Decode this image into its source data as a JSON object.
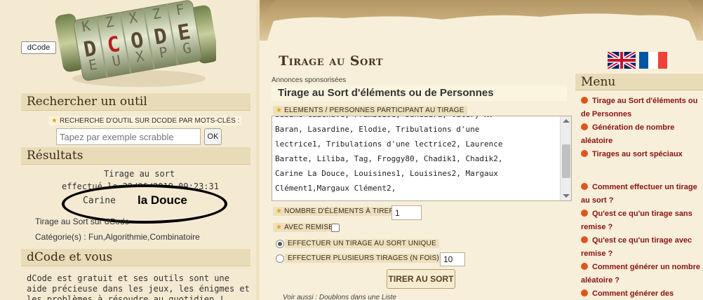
{
  "logo": {
    "badge": "dCode",
    "word": "DCODE"
  },
  "left": {
    "search": {
      "heading": "Rechercher un outil",
      "label": "RECHERCHE D'OUTIL SUR DCODE PAR MOTS-CLÉS :",
      "placeholder": "Tapez par exemple scrabble",
      "ok": "OK"
    },
    "results": {
      "heading": "Résultats",
      "line1": "Tirage au sort",
      "line2": "effectué le 22/06/2019 09:23:31",
      "carine": "Carine",
      "douce": "la Douce",
      "sur": "Tirage au Sort sur dCode",
      "cat": "Catégorie(s) : Fun,Algorithmie,Combinatoire"
    },
    "vous": {
      "heading": "dCode et vous",
      "desc": "dCode est gratuit et ses outils sont une aide précieuse dans les jeux, les énigmes et les problèmes à résoudre au quotidien !"
    }
  },
  "main": {
    "title": "Tirage au Sort",
    "sponsored": "Annonces sponsorisées",
    "ad": "Tirage au Sort d'éléments ou de Personnes",
    "elements_label": "ELEMENTS / PERSONNES PARTICIPANT AU TIRAGE",
    "textarea_lines": [
      "Sabine Cazenave, Framboise, Sandaura, Valery K.",
      "Baran, Lasardine, Elodie, Tribulations d'une",
      "lectrice1, Tribulations d'une lectrice2, Laurence",
      "Baratte, Liliba, Tag, Froggy80, Chadik1, Chadik2,",
      "Carine La Douce, Louisines1, Louisines2, Margaux",
      "Clément1,Margaux Clément2,"
    ],
    "nb_label": "NOMBRE D'ÉLÉMENTS À TIRER",
    "nb_value": "1",
    "remise_label": "AVEC REMISE",
    "unique_label": "EFFECTUER UN TIRAGE AU SORT UNIQUE",
    "multi_label": "EFFECTUER PLUSIEURS TIRAGES (N FOIS) N=",
    "multi_value": "10",
    "button": "TIRER AU SORT",
    "see_also": "Voir aussi : Doublons dans une Liste"
  },
  "menu": {
    "heading": "Menu",
    "items": [
      "Tirage au Sort d'éléments ou de Personnes",
      "Génération de nombre aléatoire",
      "Tirages au sort spéciaux",
      "Comment effectuer un tirage au sort ?",
      "Qu'est ce qu'un tirage sans remise ?",
      "Qu'est ce qu'un tirage avec remise ?",
      "Comment générer un nombre aléatoire ?",
      "Comment générer des"
    ]
  }
}
